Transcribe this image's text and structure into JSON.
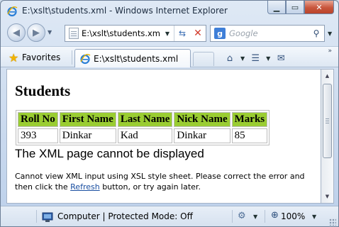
{
  "window": {
    "title": "E:\\xslt\\students.xml - Windows Internet Explorer"
  },
  "navigation": {
    "address": "E:\\xslt\\students.xm",
    "search_placeholder": "Google"
  },
  "toolbar": {
    "favorites_label": "Favorites",
    "tab_label": "E:\\xslt\\students.xml",
    "more_label": "»"
  },
  "page": {
    "heading": "Students",
    "table": {
      "columns": [
        "Roll No",
        "First Name",
        "Last Name",
        "Nick Name",
        "Marks"
      ],
      "rows": [
        [
          "393",
          "Dinkar",
          "Kad",
          "Dinkar",
          "85"
        ]
      ],
      "header_color": "#9acd32"
    },
    "error_title": "The XML page cannot be displayed",
    "error_message_before": "Cannot view XML input using XSL style sheet. Please correct the error and then click the ",
    "error_link": "Refresh",
    "error_message_after": " button, or try again later."
  },
  "status": {
    "text": "Computer | Protected Mode: Off",
    "zoom": "100%"
  },
  "icons": {
    "app": "ie-icon",
    "back": "back-arrow-icon",
    "forward": "forward-arrow-icon",
    "compat": "compatibility-view-icon",
    "stop": "stop-icon",
    "search_provider": "google-icon",
    "search": "search-icon",
    "favorites": "star-icon",
    "home": "home-icon",
    "feeds": "rss-icon",
    "read_mail": "mail-icon",
    "security": "shield-icon",
    "zoom": "magnifier-icon"
  }
}
